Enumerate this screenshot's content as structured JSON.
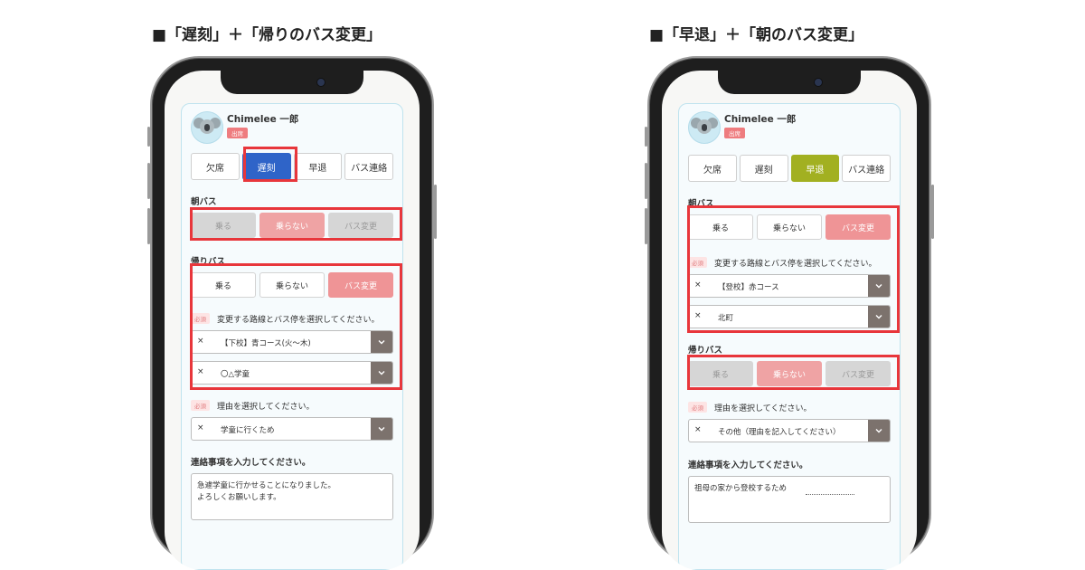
{
  "captions": {
    "left": "■「遅刻」＋「帰りのバス変更」",
    "right": "■「早退」＋「朝のバス変更」"
  },
  "left_phone": {
    "user_name": "Chimelee 一郎",
    "status_badge": "出席",
    "tabs": [
      "欠席",
      "遅刻",
      "早退",
      "バス連絡"
    ],
    "selected_tab": "遅刻",
    "morning_bus": {
      "label": "朝バス",
      "options": [
        "乗る",
        "乗らない",
        "バス変更"
      ],
      "selected": "乗らない",
      "disabled": true
    },
    "return_bus": {
      "label": "帰りバス",
      "options": [
        "乗る",
        "乗らない",
        "バス変更"
      ],
      "selected": "バス変更"
    },
    "route_required": "必須",
    "route_prompt": "変更する路線とバス停を選択してください。",
    "route_select": {
      "clear": "×",
      "value": "【下校】青コース(火〜木)"
    },
    "stop_select": {
      "clear": "×",
      "value": "〇△学童"
    },
    "reason_required": "必須",
    "reason_prompt": "理由を選択してください。",
    "reason_select": {
      "clear": "×",
      "value": "学童に行くため"
    },
    "message_prompt": "連絡事項を入力してください。",
    "message_text": "急遽学童に行かせることになりました。\nよろしくお願いします。"
  },
  "right_phone": {
    "user_name": "Chimelee 一郎",
    "status_badge": "出席",
    "tabs": [
      "欠席",
      "遅刻",
      "早退",
      "バス連絡"
    ],
    "selected_tab": "早退",
    "morning_bus": {
      "label": "朝バス",
      "options": [
        "乗る",
        "乗らない",
        "バス変更"
      ],
      "selected": "バス変更"
    },
    "route_required": "必須",
    "route_prompt": "変更する路線とバス停を選択してください。",
    "route_select": {
      "clear": "×",
      "value": "【登校】赤コース"
    },
    "stop_select": {
      "clear": "×",
      "value": "北町"
    },
    "return_bus": {
      "label": "帰りバス",
      "options": [
        "乗る",
        "乗らない",
        "バス変更"
      ],
      "selected": "乗らない",
      "disabled": true
    },
    "reason_required": "必須",
    "reason_prompt": "理由を選択してください。",
    "reason_select": {
      "clear": "×",
      "value": "その他（理由を記入してください）"
    },
    "message_prompt": "連絡事項を入力してください。",
    "message_text": "祖母の家から登校するため"
  },
  "colors": {
    "highlight": "#e8363b",
    "tab_late": "#2f64c8",
    "tab_early": "#a2b021",
    "selected_option": "#ef9496",
    "select_chevron": "#7c726d"
  },
  "icons": {
    "avatar": "koala-icon",
    "dropdown": "chevron-down-icon",
    "clear": "clear-x"
  }
}
